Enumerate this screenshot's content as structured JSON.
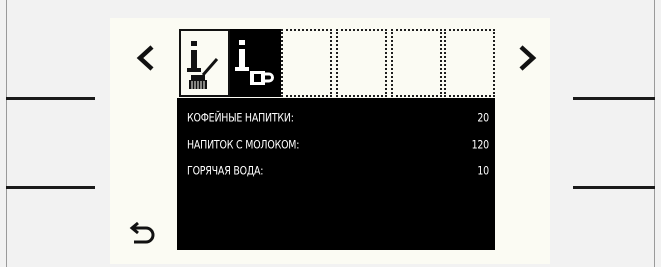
{
  "stats": {
    "items": [
      {
        "label": "КОФЕЙНЫЕ НАПИТКИ:",
        "value": "20"
      },
      {
        "label": "НАПИТОК С МОЛОКОМ:",
        "value": "120"
      },
      {
        "label": "ГОРЯЧАЯ ВОДА:",
        "value": "10"
      }
    ]
  },
  "tabs": [
    {
      "icon": "info-cleaning-brush-icon",
      "state": "selected"
    },
    {
      "icon": "info-coffee-cup-icon",
      "state": "active"
    },
    {
      "icon": "",
      "state": "empty"
    },
    {
      "icon": "",
      "state": "empty"
    },
    {
      "icon": "",
      "state": "empty"
    },
    {
      "icon": "",
      "state": "empty"
    }
  ],
  "nav": {
    "prev_icon": "chevron-left-icon",
    "next_icon": "chevron-right-icon",
    "back_icon": "back-arrow-icon"
  },
  "colors": {
    "screen_bg": "#fbfbf3",
    "panel_bg": "#000000",
    "panel_text": "#ffffff"
  }
}
